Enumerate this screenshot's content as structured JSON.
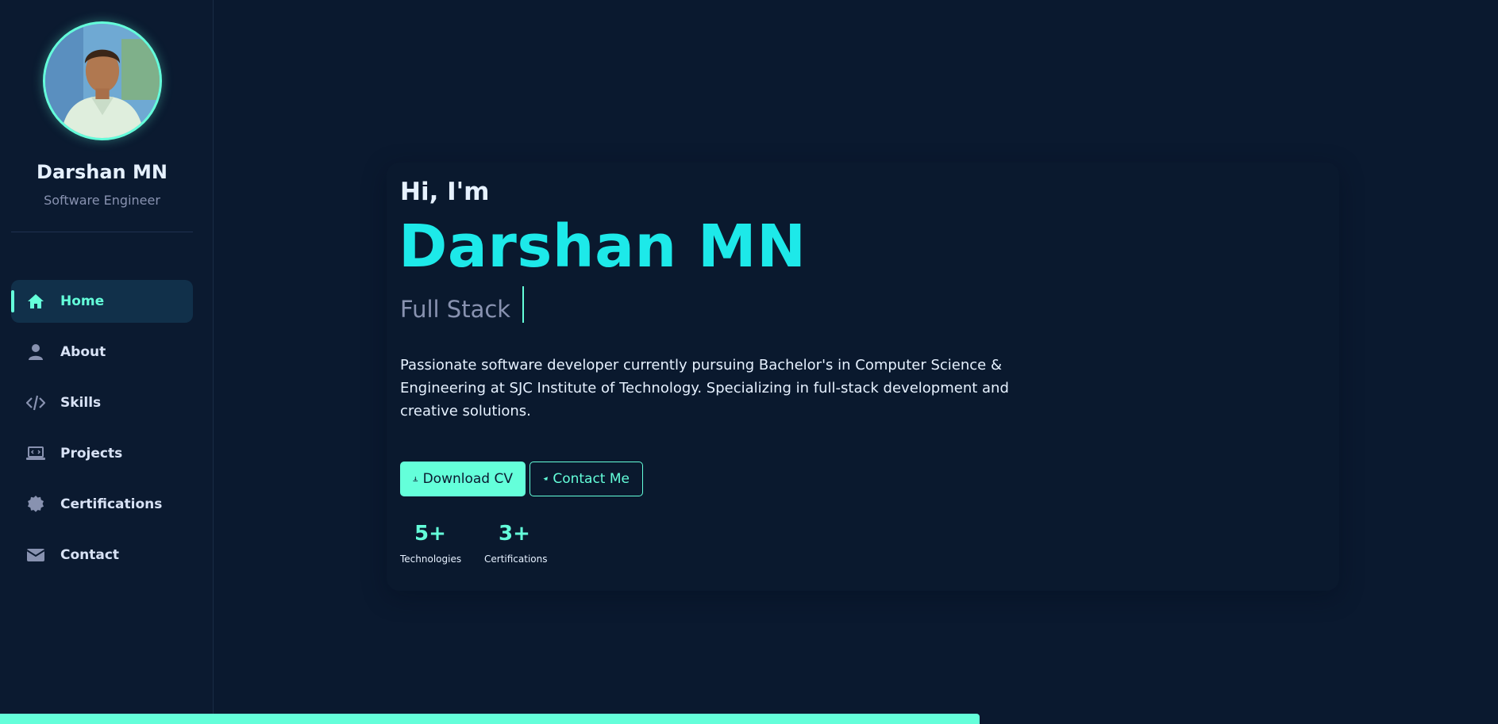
{
  "profile": {
    "name": "Darshan MN",
    "role": "Software Engineer",
    "avatar_alt": "profile-photo"
  },
  "nav": {
    "items": [
      {
        "label": "Home",
        "icon": "home-icon",
        "active": true
      },
      {
        "label": "About",
        "icon": "user-icon",
        "active": false
      },
      {
        "label": "Skills",
        "icon": "code-icon",
        "active": false
      },
      {
        "label": "Projects",
        "icon": "laptop-code-icon",
        "active": false
      },
      {
        "label": "Certifications",
        "icon": "certificate-icon",
        "active": false
      },
      {
        "label": "Contact",
        "icon": "envelope-icon",
        "active": false
      }
    ]
  },
  "hero": {
    "greeting": "Hi, I'm",
    "name": "Darshan MN",
    "typed_text": "Full Stack",
    "description": "Passionate software developer currently pursuing Bachelor's in Computer Science & Engineering at SJC Institute of Technology. Specializing in full-stack development and creative solutions.",
    "buttons": {
      "download_label": "Download CV",
      "download_icon": "download-icon",
      "contact_label": "Contact Me",
      "contact_icon": "paper-plane-icon"
    },
    "stats": [
      {
        "value": "5+",
        "label": "Technologies"
      },
      {
        "value": "3+",
        "label": "Certifications"
      }
    ]
  },
  "scroll_progress": 0.654,
  "colors": {
    "background": "#0a192f",
    "accent": "#64ffda",
    "name_highlight": "#1de9e9",
    "muted_text": "#8892b0",
    "text": "#e6f1ff"
  }
}
